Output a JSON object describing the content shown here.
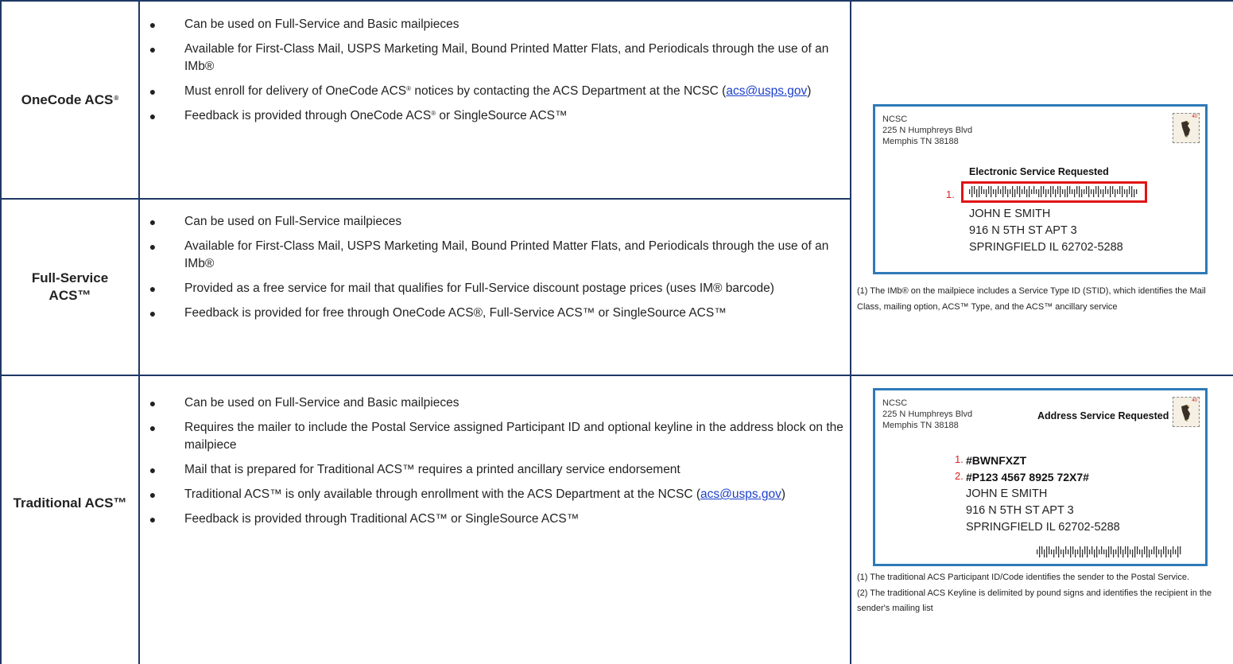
{
  "colors": {
    "grid": "#1f3864",
    "envelope_border": "#2f7ab8",
    "highlight": "#e01414",
    "link": "#1a3fcc"
  },
  "rows": [
    {
      "label": "OneCode ACS",
      "label_sup": "®",
      "bullets": [
        {
          "text": "Can be used on Full-Service and Basic mailpieces"
        },
        {
          "text": "Available for First-Class Mail, USPS Marketing Mail, Bound Printed Matter Flats, and Periodicals through the use of an IMb®"
        },
        {
          "pre": "Must enroll for delivery of OneCode ACS",
          "sup": "®",
          "post": " notices by contacting the ACS Department at the NCSC (",
          "link": "acs@usps.gov",
          "end": ")"
        },
        {
          "pre": "Feedback is provided through OneCode ACS",
          "sup": "®",
          "post": " or SingleSource ACS™"
        }
      ]
    },
    {
      "label": "Full-Service ACS™",
      "bullets": [
        {
          "text": "Can be used on Full-Service mailpieces"
        },
        {
          "text": "Available for First-Class Mail, USPS Marketing Mail, Bound Printed Matter Flats, and Periodicals through the use of an IMb®"
        },
        {
          "text": "Provided as a free service for mail that qualifies for Full-Service discount postage prices (uses IM® barcode)"
        },
        {
          "text": "Feedback is provided for free through OneCode ACS®, Full-Service ACS™ or SingleSource ACS™"
        }
      ]
    },
    {
      "label": "Traditional ACS™",
      "bullets": [
        {
          "text": "Can be used on Full-Service and Basic mailpieces"
        },
        {
          "text": "Requires the mailer to include the Postal Service assigned Participant ID and optional keyline in the address block on the mailpiece"
        },
        {
          "text": "Mail that is prepared for Traditional ACS™ requires a printed ancillary service endorsement"
        },
        {
          "pre": "Traditional ACS™  is only available through enrollment with the ACS Department at the NCSC (",
          "link": "acs@usps.gov",
          "end": ")"
        },
        {
          "text": "Feedback is provided through Traditional ACS™ or SingleSource ACS™"
        }
      ]
    }
  ],
  "envelope1": {
    "return_lines": [
      "NCSC",
      "225 N Humphreys Blvd",
      "Memphis TN 38188"
    ],
    "stamp_value": "40",
    "endorsement": "Electronic Service Requested",
    "marker": "1.",
    "recipient": [
      "JOHN E SMITH",
      "916 N 5TH ST APT 3",
      "SPRINGFIELD IL  62702-5288"
    ],
    "caption": "(1) The IMb®  on the mailpiece includes a Service Type ID (STID), which identifies the Mail Class, mailing option, ACS™ Type, and the ACS™ ancillary service"
  },
  "envelope2": {
    "return_lines": [
      "NCSC",
      "225 N Humphreys Blvd",
      "Memphis TN 38188"
    ],
    "stamp_value": "40",
    "endorsement": "Address Service Requested",
    "marker1": "1.",
    "participant_id": "#BWNFXZT",
    "marker2": "2.",
    "keyline": "#P123 4567 8925 72X7#",
    "recipient": [
      "JOHN E SMITH",
      "916 N 5TH ST APT 3",
      "SPRINGFIELD IL  62702-5288"
    ],
    "caption1": "(1) The traditional ACS Participant ID/Code identifies the sender to the Postal Service.",
    "caption2": "(2) The traditional ACS Keyline is delimited by pound signs and identifies the recipient in the sender's mailing list"
  }
}
